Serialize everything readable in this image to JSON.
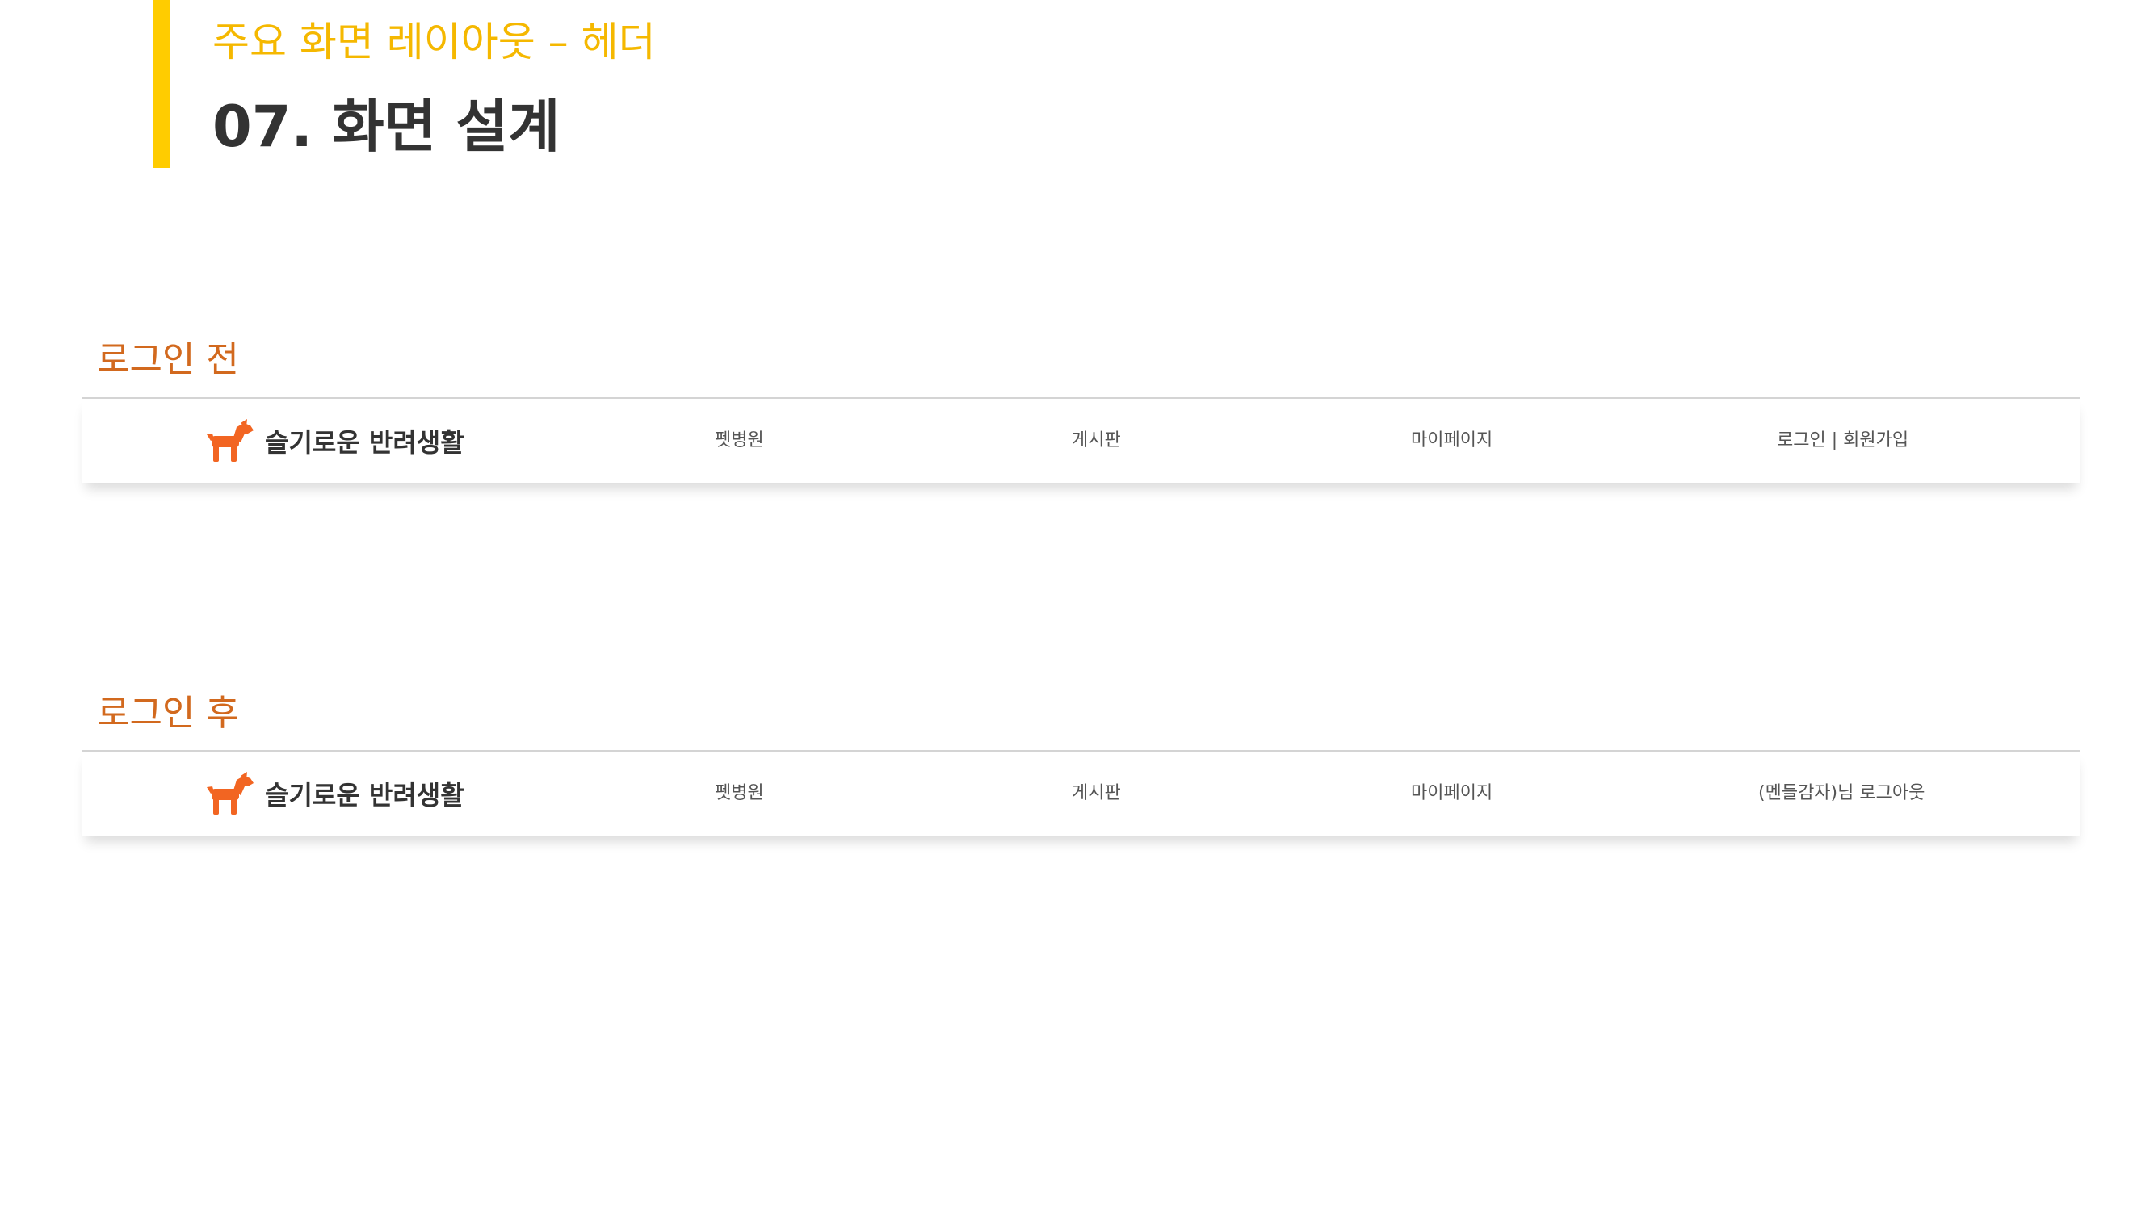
{
  "slide": {
    "subtitle": "주요 화면 레이아웃 – 헤더",
    "title": "07. 화면 설계",
    "accent_color": "#FFCC00",
    "subtitle_color": "#F5B800",
    "label_color": "#D2691E"
  },
  "before_login": {
    "label": "로그인 전",
    "header": {
      "logo_icon": "dog-icon",
      "logo_text": "슬기로운 반려생활",
      "nav": [
        "펫병원",
        "게시판",
        "마이페이지"
      ],
      "auth": "로그인 | 회원가입"
    }
  },
  "after_login": {
    "label": "로그인 후",
    "header": {
      "logo_icon": "dog-icon",
      "logo_text": "슬기로운 반려생활",
      "nav": [
        "펫병원",
        "게시판",
        "마이페이지"
      ],
      "auth": "(멘들감자)님 로그아웃"
    }
  },
  "icon_color": "#F26522"
}
